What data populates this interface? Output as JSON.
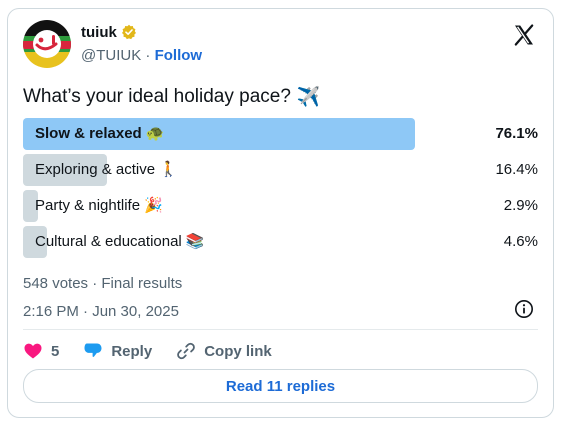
{
  "author": {
    "name": "tuiuk",
    "handle": "@TUIUK",
    "separator": "·",
    "follow_label": "Follow"
  },
  "tweet": {
    "question": "What’s your ideal holiday pace?",
    "question_emoji": "✈️"
  },
  "poll": {
    "options": [
      {
        "label": "Slow & relaxed",
        "emoji": "🐢",
        "percent": "76.1%",
        "fraction": 0.761,
        "winner": true
      },
      {
        "label": "Exploring & active",
        "emoji": "🚶",
        "percent": "16.4%",
        "fraction": 0.164,
        "winner": false
      },
      {
        "label": "Party & nightlife",
        "emoji": "🎉",
        "percent": "2.9%",
        "fraction": 0.029,
        "winner": false
      },
      {
        "label": "Cultural & educational",
        "emoji": "📚",
        "percent": "4.6%",
        "fraction": 0.046,
        "winner": false
      }
    ],
    "results_text": "548 votes · Final results"
  },
  "timestamp": "2:16 PM · Jun 30, 2025",
  "actions": {
    "like_count": "5",
    "reply_label": "Reply",
    "copy_link_label": "Copy link"
  },
  "replies_button_label": "Read 11 replies",
  "colors": {
    "winner_bar": "#8ec8f6",
    "bar": "#cfd9de",
    "link": "#1d6bd6",
    "like": "#f91880",
    "reply": "#1d9bf0"
  }
}
